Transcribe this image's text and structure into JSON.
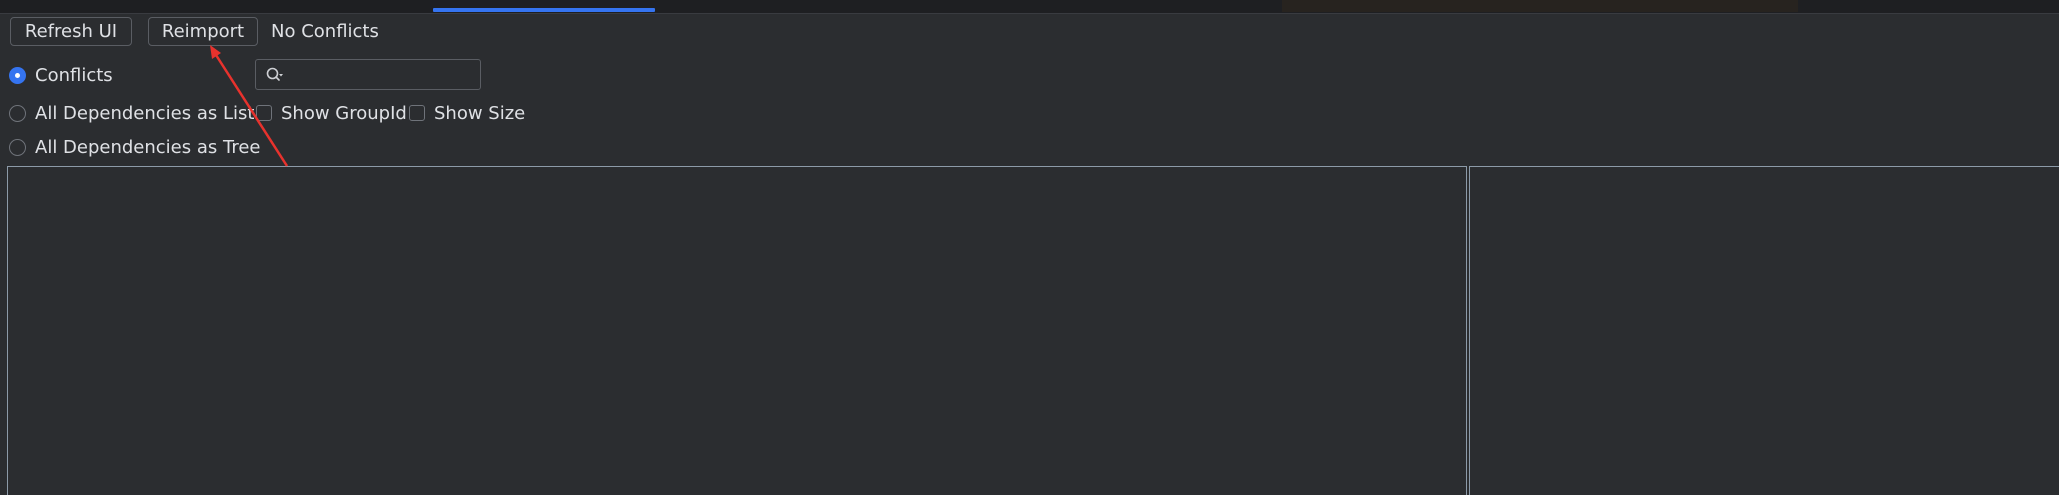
{
  "toolbar": {
    "refresh_label": "Refresh UI",
    "reimport_label": "Reimport",
    "status": "No Conflicts"
  },
  "modes": [
    {
      "label": "Conflicts",
      "selected": true
    },
    {
      "label": "All Dependencies as List",
      "selected": false
    },
    {
      "label": "All Dependencies as Tree",
      "selected": false
    }
  ],
  "search": {
    "placeholder": "",
    "value": "",
    "icon": "search-icon"
  },
  "options": [
    {
      "label": "Show GroupId",
      "checked": false
    },
    {
      "label": "Show Size",
      "checked": false
    }
  ],
  "colors": {
    "background": "#2b2d30",
    "accent": "#3574f0",
    "annotation_arrow": "#e8322d",
    "panel_border": "#8c9aa8"
  }
}
